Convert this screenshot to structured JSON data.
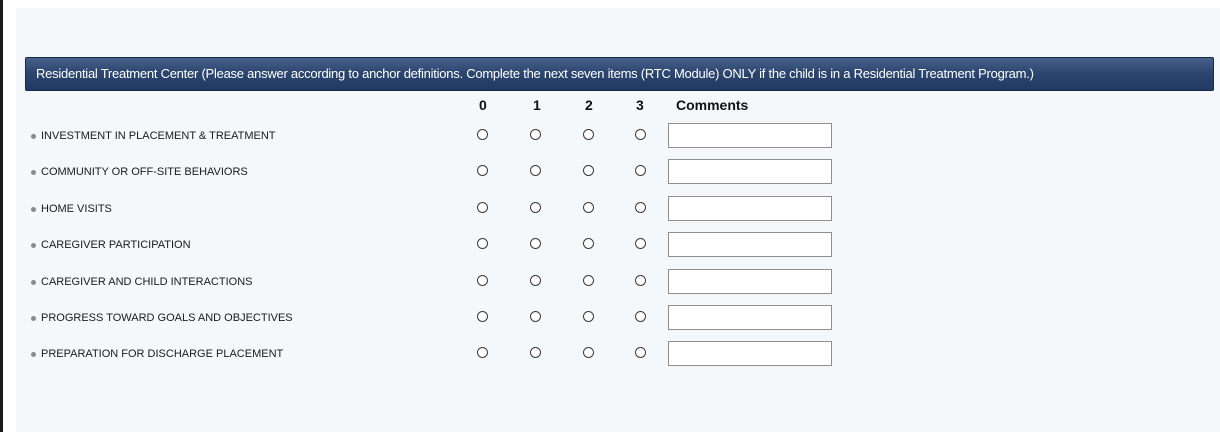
{
  "section": {
    "header": "Residential Treatment Center (Please answer according to anchor definitions. Complete the next seven items (RTC Module) ONLY if the child is in a Residential Treatment Program.)"
  },
  "columns": {
    "scores": [
      "0",
      "1",
      "2",
      "3"
    ],
    "comments": "Comments"
  },
  "items": [
    {
      "label": "INVESTMENT IN PLACEMENT & TREATMENT",
      "selected": null,
      "comment": ""
    },
    {
      "label": "COMMUNITY OR OFF-SITE BEHAVIORS",
      "selected": null,
      "comment": ""
    },
    {
      "label": "HOME VISITS",
      "selected": null,
      "comment": ""
    },
    {
      "label": "CAREGIVER PARTICIPATION",
      "selected": null,
      "comment": ""
    },
    {
      "label": "CAREGIVER AND CHILD INTERACTIONS",
      "selected": null,
      "comment": ""
    },
    {
      "label": "PROGRESS TOWARD GOALS AND OBJECTIVES",
      "selected": null,
      "comment": ""
    },
    {
      "label": "PREPARATION FOR DISCHARGE PLACEMENT",
      "selected": null,
      "comment": ""
    }
  ],
  "colors": {
    "header_bg": "#2c4670",
    "header_text": "#ffffff",
    "panel_bg": "#f4f8fb"
  }
}
